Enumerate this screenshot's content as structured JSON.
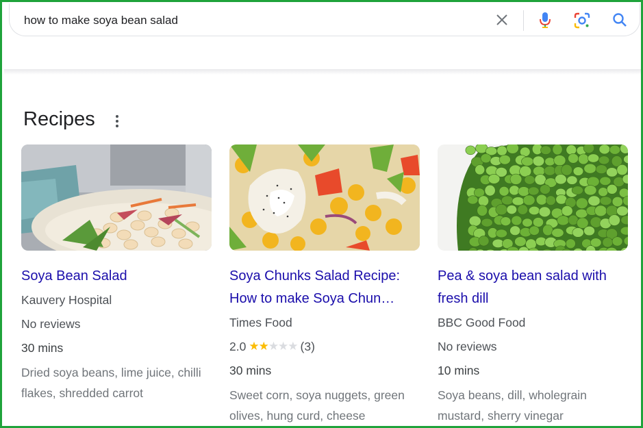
{
  "search": {
    "query": "how to make soya bean salad"
  },
  "section": {
    "title": "Recipes"
  },
  "colors": {
    "link": "#1a0dab",
    "frame": "#1fa33b",
    "star": "#fbbc04"
  },
  "recipes": [
    {
      "title": "Soya Bean Salad",
      "source": "Kauvery Hospital",
      "reviews": "No reviews",
      "time": "30 mins",
      "ingredients": "Dried soya beans, lime juice, chilli flakes, shredded carrot"
    },
    {
      "title": "Soya Chunks Salad Recipe: How to make Soya Chun…",
      "source": "Times Food",
      "rating_value": "2.0",
      "rating_stars": 2,
      "rating_count": "(3)",
      "time": "30 mins",
      "ingredients": "Sweet corn, soya nuggets, green olives, hung curd, cheese"
    },
    {
      "title": "Pea & soya bean salad with fresh dill",
      "source": "BBC Good Food",
      "reviews": "No reviews",
      "time": "10 mins",
      "ingredients": "Soya beans, dill, wholegrain mustard, sherry vinegar"
    }
  ]
}
